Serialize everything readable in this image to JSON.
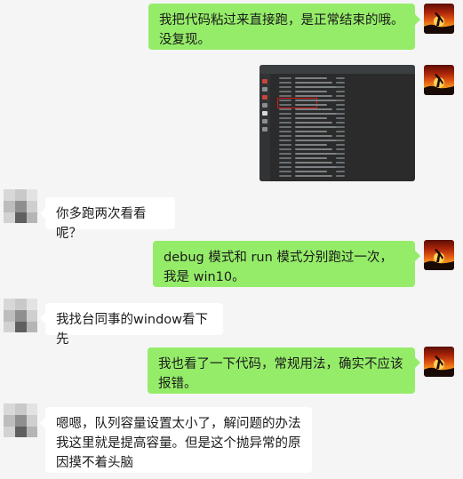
{
  "messages": [
    {
      "from": "me",
      "type": "text",
      "text": "我把代码粘过来直接跑，是正常结束的哦。没复现。"
    },
    {
      "from": "me",
      "type": "image",
      "image": "ide-console-screenshot"
    },
    {
      "from": "other",
      "type": "text",
      "text": "你多跑两次看看呢？"
    },
    {
      "from": "me",
      "type": "text",
      "text": "debug 模式和 run 模式分别跑过一次，我是 win10。"
    },
    {
      "from": "other",
      "type": "text",
      "text": "我找台同事的window看下先"
    },
    {
      "from": "me",
      "type": "text",
      "text": "我也看了一下代码，常规用法，确实不应该报错。"
    },
    {
      "from": "other",
      "type": "text",
      "text": "嗯嗯，队列容量设置太小了，解问题的办法我这里就是提高容量。但是这个抛异常的原因摸不着头脑"
    }
  ],
  "colors": {
    "background": "#f5f5f5",
    "my_bubble": "#95ec69",
    "other_bubble": "#ffffff",
    "ide_background": "#2b2b2b",
    "highlight_box": "#d41b1b"
  },
  "icons": {
    "my_avatar": "sunset-silhouette-avatar",
    "other_avatar": "pixelated-avatar"
  }
}
